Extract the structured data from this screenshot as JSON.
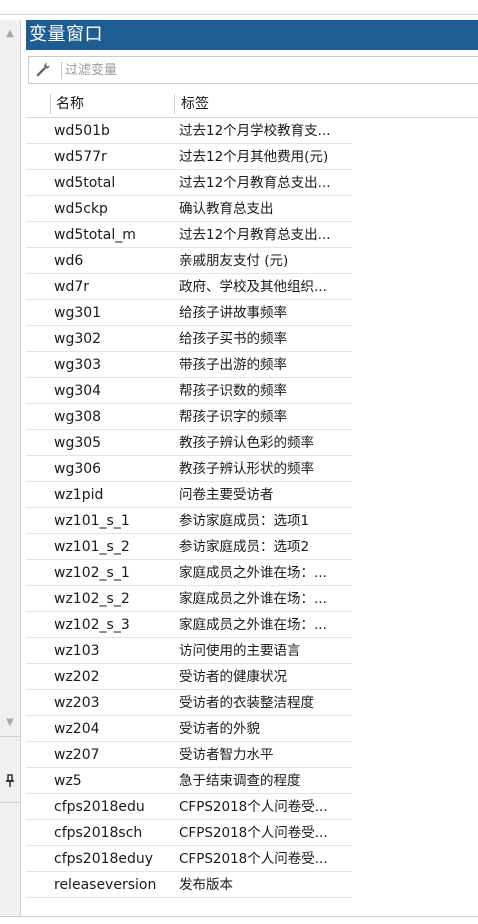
{
  "window": {
    "title": "变量窗口"
  },
  "filter": {
    "icon": "wrench-icon",
    "placeholder": "过滤变量",
    "value": ""
  },
  "table": {
    "headers": {
      "name": "名称",
      "label": "标签"
    },
    "rows": [
      {
        "name": "wd501b",
        "label": "过去12个月学校教育支..."
      },
      {
        "name": "wd577r",
        "label": "过去12个月其他费用(元)"
      },
      {
        "name": "wd5total",
        "label": "过去12个月教育总支出..."
      },
      {
        "name": "wd5ckp",
        "label": "确认教育总支出"
      },
      {
        "name": "wd5total_m",
        "label": "过去12个月教育总支出..."
      },
      {
        "name": "wd6",
        "label": "亲戚朋友支付 (元)"
      },
      {
        "name": "wd7r",
        "label": "政府、学校及其他组织..."
      },
      {
        "name": "wg301",
        "label": "给孩子讲故事频率"
      },
      {
        "name": "wg302",
        "label": "给孩子买书的频率"
      },
      {
        "name": "wg303",
        "label": "带孩子出游的频率"
      },
      {
        "name": "wg304",
        "label": "帮孩子识数的频率"
      },
      {
        "name": "wg308",
        "label": "帮孩子识字的频率"
      },
      {
        "name": "wg305",
        "label": "教孩子辨认色彩的频率"
      },
      {
        "name": "wg306",
        "label": "教孩子辨认形状的频率"
      },
      {
        "name": "wz1pid",
        "label": "问卷主要受访者"
      },
      {
        "name": "wz101_s_1",
        "label": "参访家庭成员：选项1"
      },
      {
        "name": "wz101_s_2",
        "label": "参访家庭成员：选项2"
      },
      {
        "name": "wz102_s_1",
        "label": "家庭成员之外谁在场：..."
      },
      {
        "name": "wz102_s_2",
        "label": "家庭成员之外谁在场：..."
      },
      {
        "name": "wz102_s_3",
        "label": "家庭成员之外谁在场：..."
      },
      {
        "name": "wz103",
        "label": "访问使用的主要语言"
      },
      {
        "name": "wz202",
        "label": "受访者的健康状况"
      },
      {
        "name": "wz203",
        "label": "受访者的衣装整洁程度"
      },
      {
        "name": "wz204",
        "label": "受访者的外貌"
      },
      {
        "name": "wz207",
        "label": "受访者智力水平"
      },
      {
        "name": "wz5",
        "label": "急于结束调查的程度"
      },
      {
        "name": "cfps2018edu",
        "label": "CFPS2018个人问卷受..."
      },
      {
        "name": "cfps2018sch",
        "label": "CFPS2018个人问卷受..."
      },
      {
        "name": "cfps2018eduy",
        "label": "CFPS2018个人问卷受..."
      },
      {
        "name": "releaseversion",
        "label": "发布版本"
      }
    ]
  },
  "side_panel": {
    "icons": [
      "chevron-up-icon",
      "chevron-down-icon",
      "pin-icon"
    ]
  },
  "colors": {
    "title_bar": "#1d5d92",
    "title_text": "#ffffff"
  }
}
